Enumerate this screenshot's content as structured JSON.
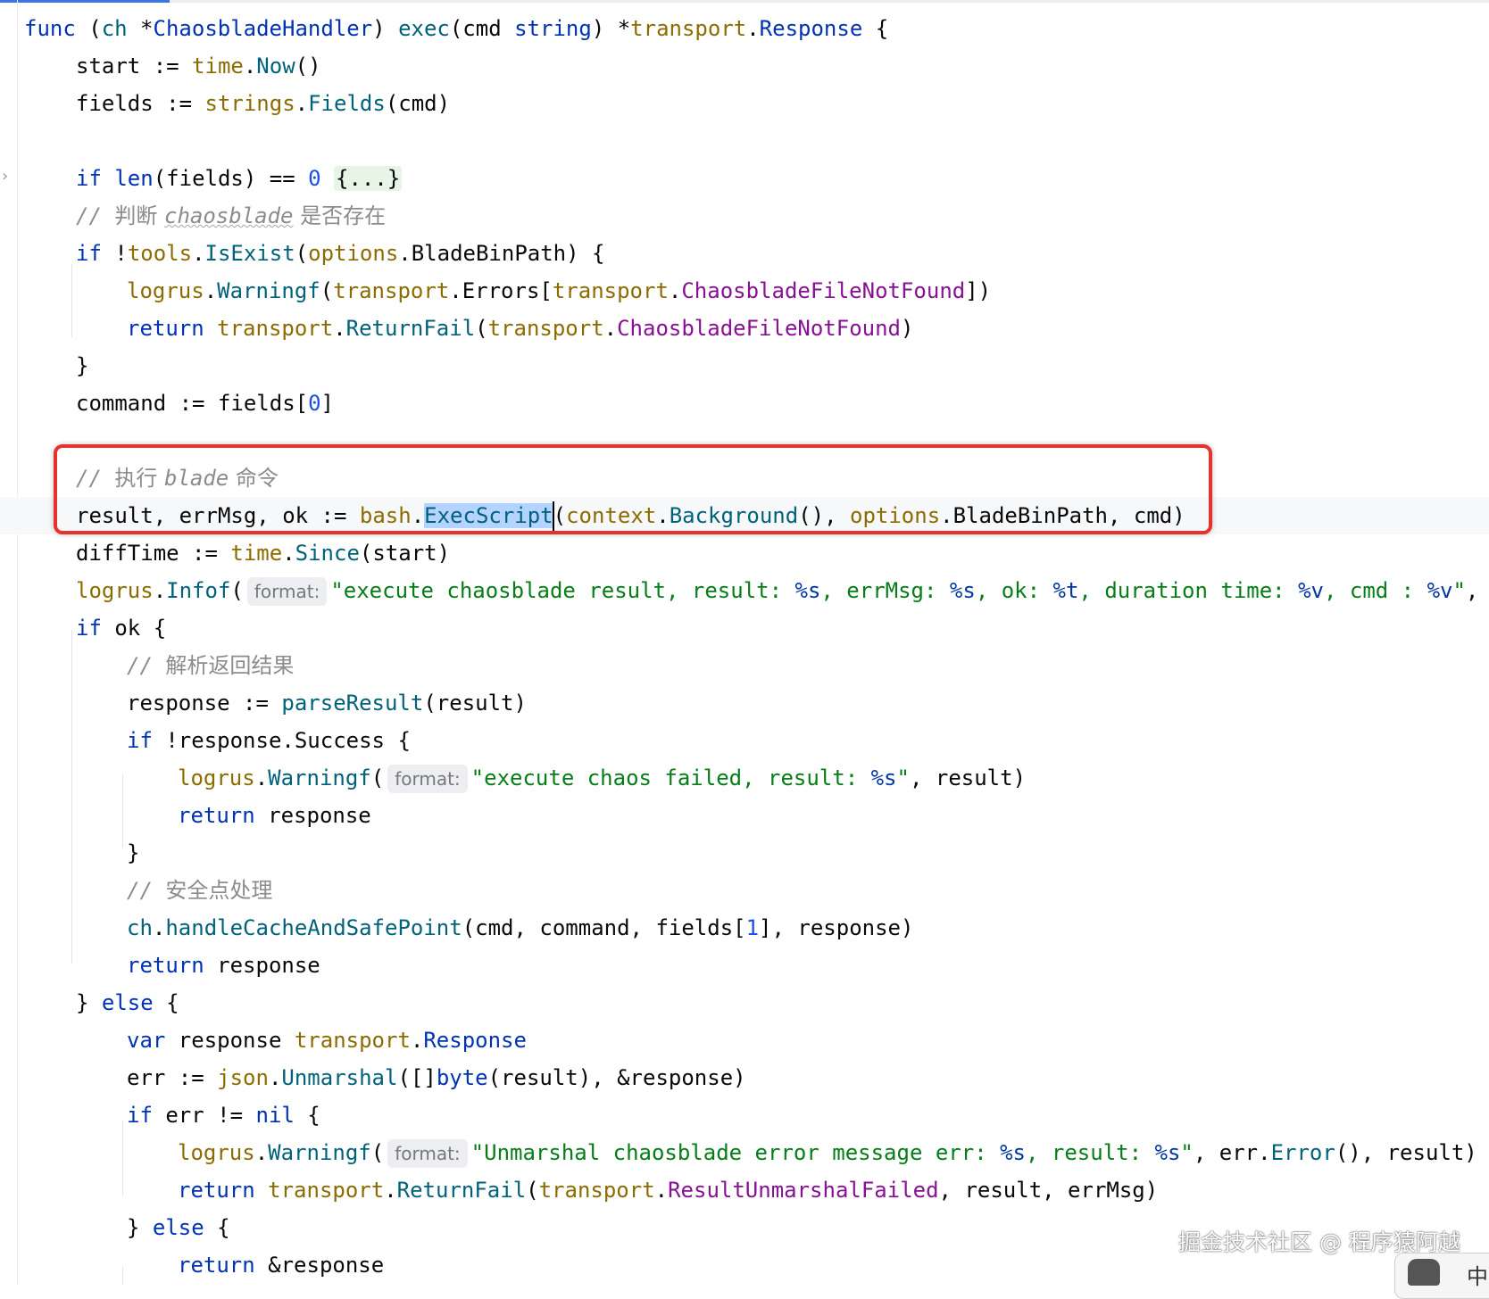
{
  "editor": {
    "language": "Go",
    "highlight_color": "#e5322d",
    "selected_identifier": "ExecScript",
    "lines": [
      {
        "t": "func (ch *ChaosbladeHandler) exec(cmd string) *transport.Response {"
      },
      {
        "t": "start := time.Now()"
      },
      {
        "t": "fields := strings.Fields(cmd)"
      },
      {
        "t": "if len(fields) == 0 {...}",
        "folded": true
      },
      {
        "t": "// 判断 chaosblade 是否存在"
      },
      {
        "t": "if !tools.IsExist(options.BladeBinPath) {"
      },
      {
        "t": "logrus.Warningf(transport.Errors[transport.ChaosbladeFileNotFound])"
      },
      {
        "t": "return transport.ReturnFail(transport.ChaosbladeFileNotFound)"
      },
      {
        "t": "}"
      },
      {
        "t": "command := fields[0]"
      },
      {
        "t": "// 执行 blade 命令"
      },
      {
        "t": "result, errMsg, ok := bash.ExecScript(context.Background(), options.BladeBinPath, cmd)"
      },
      {
        "t": "diffTime := time.Since(start)"
      },
      {
        "t": "logrus.Infof(format: \"execute chaosblade result, result: %s, errMsg: %s, ok: %t, duration time: %v, cmd : %v\","
      },
      {
        "t": "if ok {"
      },
      {
        "t": "// 解析返回结果"
      },
      {
        "t": "response := parseResult(result)"
      },
      {
        "t": "if !response.Success {"
      },
      {
        "t": "logrus.Warningf(format: \"execute chaos failed, result: %s\", result)"
      },
      {
        "t": "return response"
      },
      {
        "t": "}"
      },
      {
        "t": "// 安全点处理"
      },
      {
        "t": "ch.handleCacheAndSafePoint(cmd, command, fields[1], response)"
      },
      {
        "t": "return response"
      },
      {
        "t": "} else {"
      },
      {
        "t": "var response transport.Response"
      },
      {
        "t": "err := json.Unmarshal([]byte(result), &response)"
      },
      {
        "t": "if err != nil {"
      },
      {
        "t": "logrus.Warningf(format: \"Unmarshal chaosblade error message err: %s, result: %s\", err.Error(), result)"
      },
      {
        "t": "return transport.ReturnFail(transport.ResultUnmarshalFailed, result, errMsg)"
      },
      {
        "t": "} else {"
      },
      {
        "t": "return &response"
      }
    ],
    "hint_label": "format:"
  },
  "watermark": "掘金技术社区 @ 程序猿阿越",
  "corner_widget": {
    "label": "中",
    "icon": "bear-icon"
  }
}
